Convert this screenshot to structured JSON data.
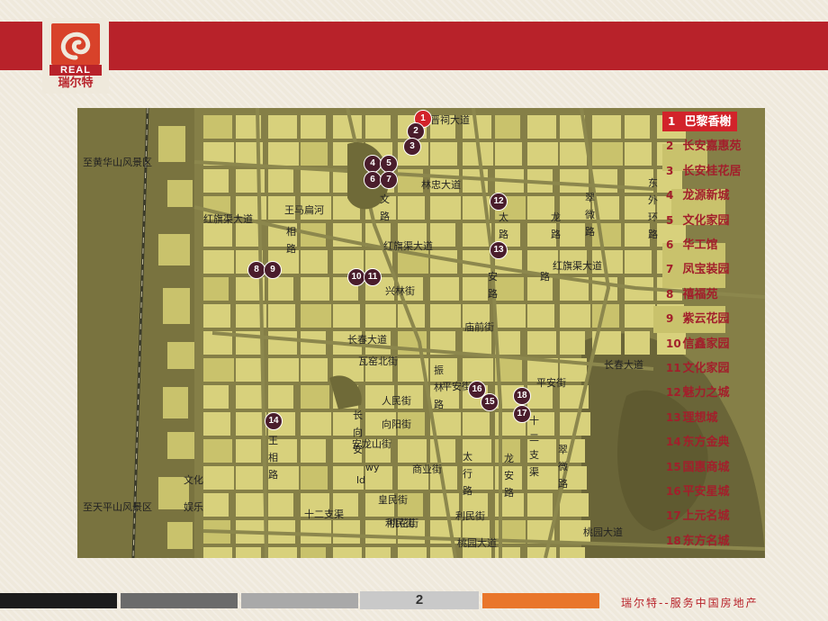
{
  "brand": {
    "logo_text": "REAL",
    "logo_cn": "瑞尔特"
  },
  "footer": {
    "page_number": "2",
    "slogan": "瑞尔特--服务中国房地产"
  },
  "colors": {
    "brand_red": "#b8222a",
    "marker": "#4a1d2c",
    "active": "#d2232a",
    "map_block": "#d8d17c",
    "map_road": "#8c874d"
  },
  "map": {
    "region_labels": [
      "至黄华山风景区",
      "至天平山风景区"
    ],
    "roads": [
      {
        "text": "晋祠大道"
      },
      {
        "text": "林忠大道"
      },
      {
        "text": "王马扁河"
      },
      {
        "text": "红旗渠大道"
      },
      {
        "text": "红旗渠大道"
      },
      {
        "text": "红旗渠大道"
      },
      {
        "text": "兴林街"
      },
      {
        "text": "庙前街"
      },
      {
        "text": "长春大道"
      },
      {
        "text": "瓦窑北街"
      },
      {
        "text": "平安街"
      },
      {
        "text": "平安街"
      },
      {
        "text": "人民街"
      },
      {
        "text": "向阳街"
      },
      {
        "text": "安龙山街"
      },
      {
        "text": "商业街"
      },
      {
        "text": "皇民街"
      },
      {
        "text": "利民街"
      },
      {
        "text": "利民街"
      },
      {
        "text": "十二支渠"
      },
      {
        "text": "桃花街"
      },
      {
        "text": "桃园大道"
      },
      {
        "text": "桃园大道"
      },
      {
        "text": "长春大道"
      },
      {
        "text": "文化"
      },
      {
        "text": "娱乐"
      }
    ],
    "vertical_roads": [
      {
        "text": "相路"
      },
      {
        "text": "王相路"
      },
      {
        "text": "文路"
      },
      {
        "text": "太路"
      },
      {
        "text": "龙路"
      },
      {
        "text": "翠微路"
      },
      {
        "text": "东外环路"
      },
      {
        "text": "安路"
      },
      {
        "text": "路"
      },
      {
        "text": "振林路"
      },
      {
        "text": "长向安"
      },
      {
        "text": "太行路"
      },
      {
        "text": "龙安路"
      },
      {
        "text": "十二支渠"
      },
      {
        "text": "翠微路"
      }
    ],
    "markers": [
      {
        "n": "1",
        "active": true
      },
      {
        "n": "2"
      },
      {
        "n": "3"
      },
      {
        "n": "4"
      },
      {
        "n": "5"
      },
      {
        "n": "6"
      },
      {
        "n": "7"
      },
      {
        "n": "8"
      },
      {
        "n": "9"
      },
      {
        "n": "10"
      },
      {
        "n": "11"
      },
      {
        "n": "12"
      },
      {
        "n": "13"
      },
      {
        "n": "14"
      },
      {
        "n": "15"
      },
      {
        "n": "16"
      },
      {
        "n": "17"
      },
      {
        "n": "18"
      }
    ],
    "small_labels": [
      "wy",
      "ld"
    ]
  },
  "legend": [
    {
      "n": "1",
      "name": "巴黎香榭",
      "active": true
    },
    {
      "n": "2",
      "name": "长安嘉惠苑"
    },
    {
      "n": "3",
      "name": "长安桂花居"
    },
    {
      "n": "4",
      "name": "龙源新城"
    },
    {
      "n": "5",
      "name": "文化家园"
    },
    {
      "n": "6",
      "name": "华工馆"
    },
    {
      "n": "7",
      "name": "凤宝装园"
    },
    {
      "n": "8",
      "name": "禧福苑"
    },
    {
      "n": "9",
      "name": "紫云花园"
    },
    {
      "n": "10",
      "name": "信鑫家园"
    },
    {
      "n": "11",
      "name": "文化家园"
    },
    {
      "n": "12",
      "name": "魅力之城"
    },
    {
      "n": "13",
      "name": "理想城"
    },
    {
      "n": "14",
      "name": "东方金典"
    },
    {
      "n": "15",
      "name": "国惠商城"
    },
    {
      "n": "16",
      "name": "平安星城"
    },
    {
      "n": "17",
      "name": "上元名城"
    },
    {
      "n": "18",
      "name": "东方名城"
    }
  ]
}
